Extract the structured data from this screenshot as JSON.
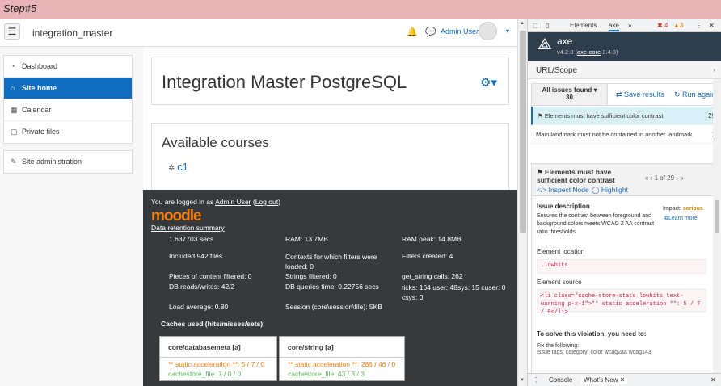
{
  "step_label": "Step#5",
  "moodle": {
    "site_name": "integration_master",
    "user_name": "Admin User",
    "sidebar": {
      "group1": [
        {
          "icon": "◔",
          "label": "Dashboard"
        },
        {
          "icon": "⌂",
          "label": "Site home",
          "active": true
        },
        {
          "icon": "▦",
          "label": "Calendar"
        },
        {
          "icon": "▢",
          "label": "Private files"
        }
      ],
      "group2": [
        {
          "icon": "✎",
          "label": "Site administration"
        }
      ]
    },
    "page_title": "Integration Master PostgreSQL",
    "available_courses": "Available courses",
    "course_link": "c1",
    "footer": {
      "logged_prefix": "You are logged in as",
      "logged_user": "Admin User",
      "logout": "Log out",
      "logo": "moodle",
      "retention": "Data retention summary",
      "stats": {
        "secs": "1.637703 secs",
        "ram": "RAM: 13.7MB",
        "ram_peak": "RAM peak: 14.8MB",
        "files": "Included 942 files",
        "contexts": "Contexts for which filters were loaded: 0",
        "filters": "Filters created: 4",
        "pieces": "Pieces of content filtered: 0",
        "strings": "Strings filtered: 0",
        "get_string": "get_string calls: 262",
        "db_rw": "DB reads/writes: 42/2",
        "db_time": "DB queries time: 0.22756 secs",
        "ticks": "ticks: 164 user: 48sys: 15 cuser: 0 csys: 0",
        "load": "Load average: 0.80",
        "session": "Session (core\\session\\file): 5KB"
      },
      "caches_heading": "Caches used (hits/misses/sets)",
      "caches": [
        {
          "name": "core/databasemeta [a]",
          "static": "** static acceleration **: 5 / 7 / 0",
          "file": "cachestore_file: 7 / 0 / 0"
        },
        {
          "name": "core/string [a]",
          "static": "** static acceleration **: 286 / 46 / 0",
          "file": "cachestore_file: 43 / 3 / 3"
        }
      ]
    }
  },
  "devtools": {
    "tabs": {
      "elements": "Elements",
      "axe": "axe",
      "more": "»",
      "errors": "4",
      "warnings": "3"
    },
    "axe": {
      "title": "axe",
      "version_prefix": "v4.2.0 (",
      "version_link": "axe-core",
      "version_suffix": " 3.4.0)",
      "url_scope": "URL/Scope",
      "all_issues": "All issues found",
      "issues_count": "30",
      "save_results": "Save results",
      "run_again": "Run again",
      "issues": [
        {
          "text": "Elements must have sufficient color contrast",
          "count": "29",
          "selected": true
        },
        {
          "text": "Main landmark must not be contained in another landmark",
          "count": "1",
          "selected": false
        }
      ],
      "detail": {
        "title": "Elements must have sufficient color contrast",
        "inspect": "Inspect Node",
        "highlight": "Highlight",
        "pager": "1 of 29",
        "issue_desc_head": "Issue description",
        "issue_desc": "Ensures the contrast between foreground and background colors meets WCAG 2 AA contrast ratio thresholds",
        "impact_label": "Impact:",
        "impact": "serious",
        "learn_more": "Learn more",
        "location_head": "Element location",
        "location": ".lowhits",
        "source_head": "Element source",
        "source": "<li class=\"cache-store-stats lowhits text-warning p-x-1\">** static acceleration **: 5 / 7 / 0</li>",
        "solve": "To solve this violation, you need to:",
        "fix": "Fix the following:",
        "tags_label": "Issue tags:",
        "tags": [
          "category: color",
          "wcag2aa",
          "wcag143"
        ]
      }
    },
    "drawer": {
      "console": "Console",
      "whats_new": "What's New"
    }
  }
}
